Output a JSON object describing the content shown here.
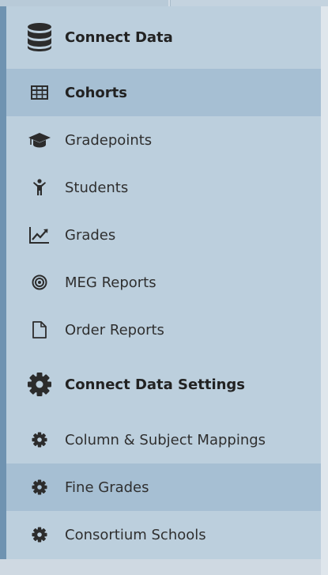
{
  "nav": {
    "connect_data": {
      "label": "Connect Data",
      "icon": "database-icon"
    },
    "cohorts": {
      "label": "Cohorts",
      "icon": "table-icon"
    },
    "gradepoints": {
      "label": "Gradepoints",
      "icon": "graduation-cap-icon"
    },
    "students": {
      "label": "Students",
      "icon": "child-icon"
    },
    "grades": {
      "label": "Grades",
      "icon": "line-chart-icon"
    },
    "meg_reports": {
      "label": "MEG Reports",
      "icon": "bullseye-icon"
    },
    "order_reports": {
      "label": "Order Reports",
      "icon": "file-icon"
    },
    "settings": {
      "label": "Connect Data Settings",
      "icon": "gear-icon"
    },
    "mappings": {
      "label": "Column & Subject Mappings",
      "icon": "gear-icon"
    },
    "fine_grades": {
      "label": "Fine Grades",
      "icon": "gear-icon"
    },
    "consortium": {
      "label": "Consortium Schools",
      "icon": "gear-icon"
    }
  },
  "colors": {
    "panel": "#bccfdd",
    "active_row": "#a6bfd3",
    "rail": "#6f93b1",
    "text": "#2f2f2f"
  }
}
